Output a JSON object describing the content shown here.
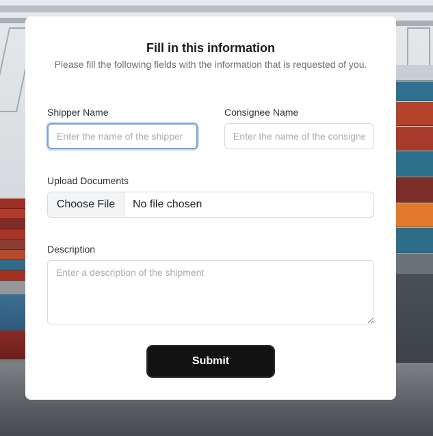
{
  "form": {
    "title": "Fill in this information",
    "subtitle": "Please fill the following fields with the information that is requested of you.",
    "shipper": {
      "label": "Shipper Name",
      "placeholder": "Enter the name of the shipper",
      "value": ""
    },
    "consignee": {
      "label": "Consignee Name",
      "placeholder": "Enter the name of the consignee",
      "value": ""
    },
    "upload": {
      "label": "Upload Documents",
      "button_label": "Choose File",
      "status": "No file chosen"
    },
    "description": {
      "label": "Description",
      "placeholder": "Enter a description of the shipment",
      "value": ""
    },
    "submit_label": "Submit"
  },
  "background": {
    "subject": "container-ship-port-photo"
  },
  "colors": {
    "card": "#ffffff",
    "title": "#161a21",
    "subtitle": "#6b6f76",
    "focus_ring": "#7aa0dc",
    "submit_bg": "#121212"
  }
}
